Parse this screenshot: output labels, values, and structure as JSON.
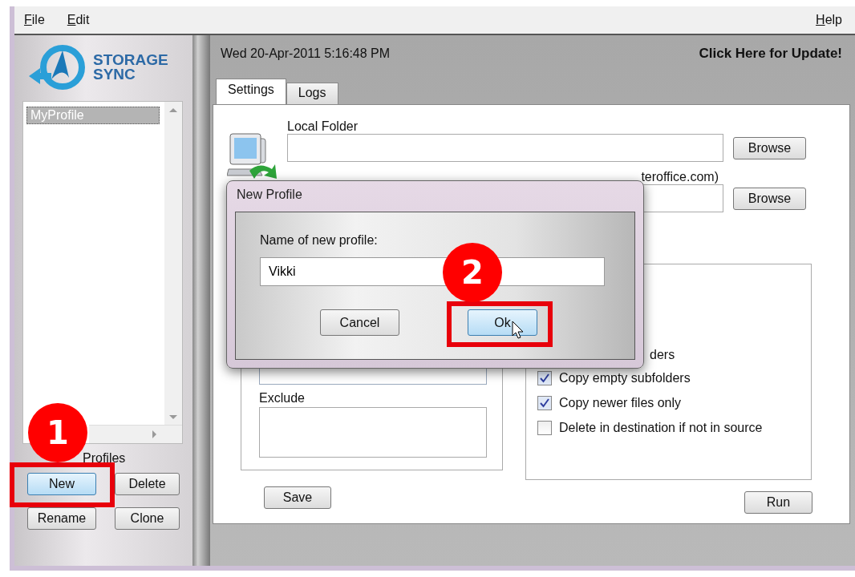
{
  "menu": [
    {
      "label": "File"
    },
    {
      "label": "Edit"
    }
  ],
  "help_menu": {
    "label": "Help"
  },
  "logo": {
    "line_1": "STORAGE",
    "line_2": "SYNC"
  },
  "profiles": {
    "items": [
      {
        "label": "MyProfile",
        "selected": true
      }
    ],
    "caption": "Profiles",
    "buttons": [
      {
        "label": "New",
        "highlighted": true
      },
      {
        "label": "Delete",
        "highlighted": false
      },
      {
        "label": "Rename",
        "highlighted": false
      },
      {
        "label": "Clone",
        "highlighted": false
      }
    ]
  },
  "datetime": "Wed 20-Apr-2011 5:16:48 PM",
  "update_link": "Click Here for Update!",
  "tabs": [
    {
      "label": "Settings",
      "selected": true
    },
    {
      "label": "Logs",
      "selected": false
    }
  ],
  "local_folder": {
    "label": "Local Folder",
    "browse": "Browse"
  },
  "remote_folder": {
    "label_tail": "teroffice.com)",
    "browse": "Browse"
  },
  "exclude": {
    "label": "Exclude"
  },
  "options_label_tail": "ders",
  "options": [
    {
      "label": "Copy empty subfolders",
      "checked": true
    },
    {
      "label": "Copy newer files only",
      "checked": true
    },
    {
      "label": "Delete in destination if not in source",
      "checked": false
    }
  ],
  "save_button": "Save",
  "run_button": "Run",
  "dialog": {
    "title": "New Profile",
    "prompt": "Name of new profile:",
    "value": "Vikki",
    "buttons": [
      {
        "label": "Cancel",
        "highlighted": false
      },
      {
        "label": "Ok",
        "highlighted": true
      }
    ]
  },
  "annotations": [
    {
      "number": "1"
    },
    {
      "number": "2"
    }
  ]
}
